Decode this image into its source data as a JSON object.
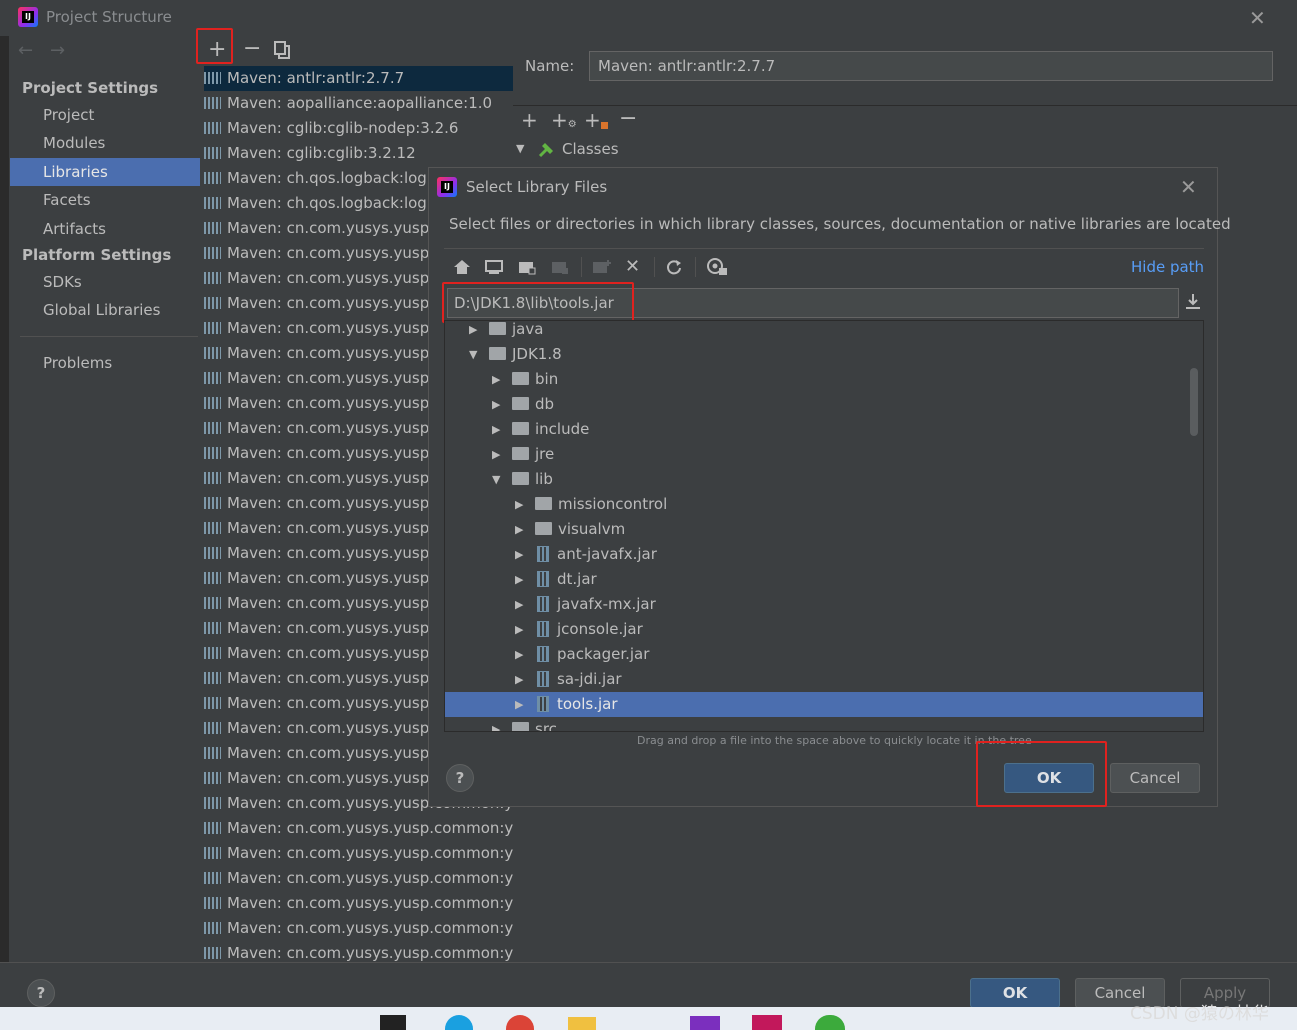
{
  "window": {
    "title": "Project Structure",
    "close": "✕"
  },
  "nav": {
    "back": "←",
    "forward": "→"
  },
  "sidebar": {
    "project_settings": "Project Settings",
    "items_ps": [
      "Project",
      "Modules",
      "Libraries",
      "Facets",
      "Artifacts"
    ],
    "platform_settings": "Platform Settings",
    "items_pl": [
      "SDKs",
      "Global Libraries"
    ],
    "problems": "Problems"
  },
  "libraries": [
    "Maven: antlr:antlr:2.7.7",
    "Maven: aopalliance:aopalliance:1.0",
    "Maven: cglib:cglib-nodep:3.2.6",
    "Maven: cglib:cglib:3.2.12",
    "Maven: ch.qos.logback:logb",
    "Maven: ch.qos.logback:logb",
    "Maven: cn.com.yusys.yusp.c",
    "Maven: cn.com.yusys.yusp.c",
    "Maven: cn.com.yusys.yusp.c",
    "Maven: cn.com.yusys.yusp.c",
    "Maven: cn.com.yusys.yusp.c",
    "Maven: cn.com.yusys.yusp.c",
    "Maven: cn.com.yusys.yusp.c",
    "Maven: cn.com.yusys.yusp.c",
    "Maven: cn.com.yusys.yusp.c",
    "Maven: cn.com.yusys.yusp.c",
    "Maven: cn.com.yusys.yusp.c",
    "Maven: cn.com.yusys.yusp.c",
    "Maven: cn.com.yusys.yusp.c",
    "Maven: cn.com.yusys.yusp.c",
    "Maven: cn.com.yusys.yusp.c",
    "Maven: cn.com.yusys.yusp.c",
    "Maven: cn.com.yusys.yusp.c",
    "Maven: cn.com.yusys.yusp.c",
    "Maven: cn.com.yusys.yusp.c",
    "Maven: cn.com.yusys.yusp.c",
    "Maven: cn.com.yusys.yusp.c",
    "Maven: cn.com.yusys.yusp.c",
    "Maven: cn.com.yusys.yusp.c",
    "Maven: cn.com.yusys.yusp.common:yu",
    "Maven: cn.com.yusys.yusp.common:yu",
    "Maven: cn.com.yusys.yusp.common:yu",
    "Maven: cn.com.yusys.yusp.common:yu",
    "Maven: cn.com.yusys.yusp.common:yu",
    "Maven: cn.com.yusys.yusp.common:yu",
    "Maven: cn.com.yusys.yusp.common:yu"
  ],
  "detail": {
    "name_label": "Name:",
    "name_value": "Maven: antlr:antlr:2.7.7",
    "classes": "Classes"
  },
  "dialog": {
    "title": "Select Library Files",
    "close": "✕",
    "description": "Select files or directories in which library classes, sources, documentation or native libraries are located",
    "hide_path": "Hide path",
    "path": "D:\\JDK1.8\\lib\\tools.jar",
    "tree": [
      {
        "label": "java",
        "type": "folder",
        "level": 1,
        "arrow": "▶"
      },
      {
        "label": "JDK1.8",
        "type": "folder",
        "level": 1,
        "arrow": "▼"
      },
      {
        "label": "bin",
        "type": "folder",
        "level": 2,
        "arrow": "▶"
      },
      {
        "label": "db",
        "type": "folder",
        "level": 2,
        "arrow": "▶"
      },
      {
        "label": "include",
        "type": "folder",
        "level": 2,
        "arrow": "▶"
      },
      {
        "label": "jre",
        "type": "folder",
        "level": 2,
        "arrow": "▶"
      },
      {
        "label": "lib",
        "type": "folder",
        "level": 2,
        "arrow": "▼"
      },
      {
        "label": "missioncontrol",
        "type": "folder",
        "level": 3,
        "arrow": "▶"
      },
      {
        "label": "visualvm",
        "type": "folder",
        "level": 3,
        "arrow": "▶"
      },
      {
        "label": "ant-javafx.jar",
        "type": "jar",
        "level": 3,
        "arrow": "▶"
      },
      {
        "label": "dt.jar",
        "type": "jar",
        "level": 3,
        "arrow": "▶"
      },
      {
        "label": "javafx-mx.jar",
        "type": "jar",
        "level": 3,
        "arrow": "▶"
      },
      {
        "label": "jconsole.jar",
        "type": "jar",
        "level": 3,
        "arrow": "▶"
      },
      {
        "label": "packager.jar",
        "type": "jar",
        "level": 3,
        "arrow": "▶"
      },
      {
        "label": "sa-jdi.jar",
        "type": "jar",
        "level": 3,
        "arrow": "▶"
      },
      {
        "label": "tools.jar",
        "type": "jar",
        "level": 3,
        "arrow": "▶"
      },
      {
        "label": "src",
        "type": "folder",
        "level": 2,
        "arrow": "▶"
      }
    ],
    "drag_hint": "Drag and drop a file into the space above to quickly locate it in the tree",
    "help": "?",
    "ok": "OK",
    "cancel": "Cancel"
  },
  "footer": {
    "help": "?",
    "ok": "OK",
    "cancel": "Cancel",
    "apply": "Apply"
  },
  "watermark": "CSDN @猿の林华",
  "colors": {
    "accent": "#4b6eaf",
    "ok_button": "#365880",
    "highlight": "#e0221f",
    "link": "#589df6"
  }
}
